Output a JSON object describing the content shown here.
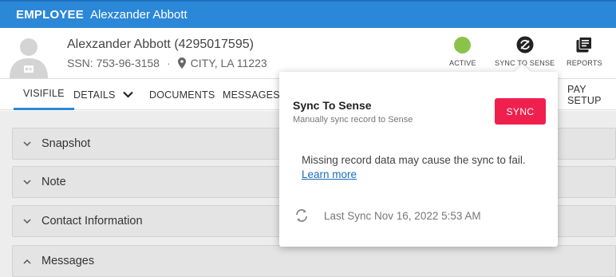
{
  "topbar": {
    "kind": "EMPLOYEE",
    "name": "Alexzander Abbott"
  },
  "employee": {
    "display_name": "Alexzander Abbott (4295017595)",
    "ssn": "SSN: 753-96-3158",
    "location": "CITY, LA 11223"
  },
  "actions": {
    "active": "ACTIVE",
    "sync": "SYNC TO SENSE",
    "reports": "REPORTS",
    "status_color": "#8bc34a"
  },
  "tabs": {
    "visifile": "VISIFILE",
    "details": "DETAILS",
    "documents": "DOCUMENTS",
    "messages": "MESSAGES",
    "pay_setup": "PAY SETUP"
  },
  "sections": [
    "Snapshot",
    "Note",
    "Contact Information",
    "Messages"
  ],
  "popover": {
    "title": "Sync To Sense",
    "subtitle": "Manually sync record to Sense",
    "button": "SYNC",
    "message": "Missing record data may cause the sync to fail.",
    "link": "Learn more",
    "last_sync": "Last Sync Nov 16, 2022 5:53 AM"
  },
  "colors": {
    "brand_blue": "#2b88d8",
    "sync_red": "#f0204e"
  }
}
